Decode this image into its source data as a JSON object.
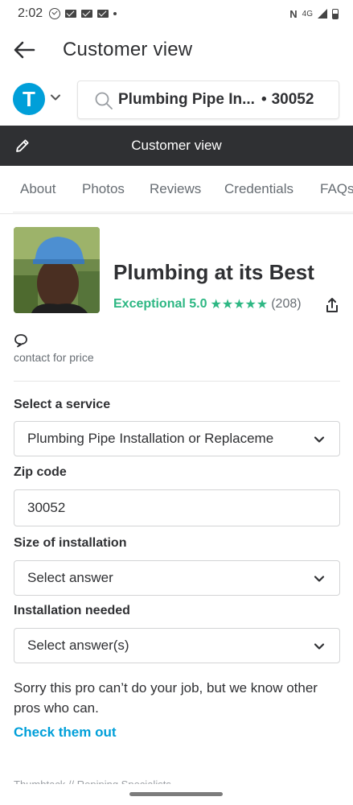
{
  "status_bar": {
    "time": "2:02",
    "network": "4G"
  },
  "app_bar": {
    "title": "Customer view"
  },
  "search": {
    "query": "Plumbing Pipe In...",
    "separator": "•",
    "zip": "30052"
  },
  "logo": {
    "letter": "T",
    "color": "#009fd9"
  },
  "banner": {
    "text": "Customer view"
  },
  "tabs": [
    "About",
    "Photos",
    "Reviews",
    "Credentials",
    "FAQs"
  ],
  "pro": {
    "name": "Plumbing at its Best",
    "rating_label": "Exceptional 5.0",
    "stars": "★★★★★",
    "reviews_count": "(208)",
    "rating_color": "#2db783"
  },
  "pricing": {
    "note": "contact for price"
  },
  "form": {
    "service_label": "Select a service",
    "service_value": "Plumbing Pipe Installation or Replaceme",
    "zip_label": "Zip code",
    "zip_value": "30052",
    "size_label": "Size of installation",
    "size_value": "Select answer",
    "needed_label": "Installation needed",
    "needed_value": "Select answer(s)"
  },
  "message": {
    "sorry": "Sorry this pro can’t do your job, but we know other pros who can.",
    "link": "Check them out"
  },
  "footer": {
    "breadcrumb": "Thumbtack // Repiping Specialists"
  },
  "icons": {
    "back": "back-arrow-icon",
    "search": "search-icon",
    "pencil": "pencil-icon",
    "share": "share-icon",
    "chat": "chat-bubble-icon",
    "chevron": "chevron-down-icon"
  }
}
